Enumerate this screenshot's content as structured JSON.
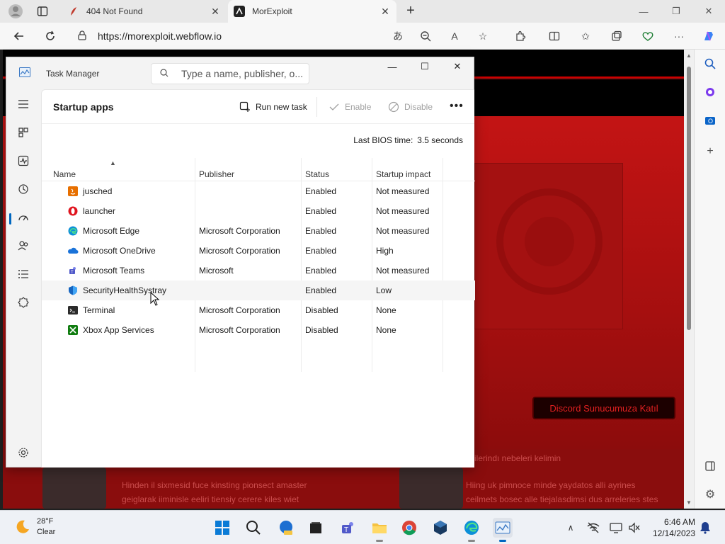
{
  "browser": {
    "tabs": [
      {
        "title": "404 Not Found"
      },
      {
        "title": "MorExploit"
      }
    ],
    "url": "https://morexploit.webflow.io"
  },
  "page": {
    "discord_button": "Discord Sunucumuza Katıl",
    "low_text_1": "ilerindı nebeleri kelimin",
    "low_text_2": "Hinden il sixmesid fuce kinsting pionsect amaster",
    "low_text_3": "geiglarak iiminisle eeliri tiensiy cerere kiles wiet",
    "low_text_4": "Hiing uk pimnoce minde yaydatos alli ayrines",
    "low_text_5": "ceilmets bosec alle tiejalasdimsi dus arreleries stes"
  },
  "task_manager": {
    "title": "Task Manager",
    "search_placeholder": "Type a name, publisher, o...",
    "page_title": "Startup apps",
    "commands": {
      "run_new_task": "Run new task",
      "enable": "Enable",
      "disable": "Disable"
    },
    "bios_label": "Last BIOS time:",
    "bios_value": "3.5 seconds",
    "columns": {
      "name": "Name",
      "publisher": "Publisher",
      "status": "Status",
      "impact": "Startup impact"
    },
    "rows": [
      {
        "name": "jusched",
        "publisher": "",
        "status": "Enabled",
        "impact": "Not measured",
        "icon": "java-icon"
      },
      {
        "name": "launcher",
        "publisher": "",
        "status": "Enabled",
        "impact": "Not measured",
        "icon": "opera-icon"
      },
      {
        "name": "Microsoft Edge",
        "publisher": "Microsoft Corporation",
        "status": "Enabled",
        "impact": "Not measured",
        "icon": "edge-icon"
      },
      {
        "name": "Microsoft OneDrive",
        "publisher": "Microsoft Corporation",
        "status": "Enabled",
        "impact": "High",
        "icon": "onedrive-icon"
      },
      {
        "name": "Microsoft Teams",
        "publisher": "Microsoft",
        "status": "Enabled",
        "impact": "Not measured",
        "icon": "teams-icon"
      },
      {
        "name": "SecurityHealthSystray",
        "publisher": "",
        "status": "Enabled",
        "impact": "Low",
        "icon": "shield-icon"
      },
      {
        "name": "Terminal",
        "publisher": "Microsoft Corporation",
        "status": "Disabled",
        "impact": "None",
        "icon": "terminal-icon"
      },
      {
        "name": "Xbox App Services",
        "publisher": "Microsoft Corporation",
        "status": "Disabled",
        "impact": "None",
        "icon": "xbox-icon"
      }
    ]
  },
  "taskbar": {
    "weather_temp": "28°F",
    "weather_desc": "Clear",
    "time": "6:46 AM",
    "date": "12/14/2023"
  },
  "colors": {
    "accent": "#0067c0",
    "page_red": "#c31414"
  }
}
